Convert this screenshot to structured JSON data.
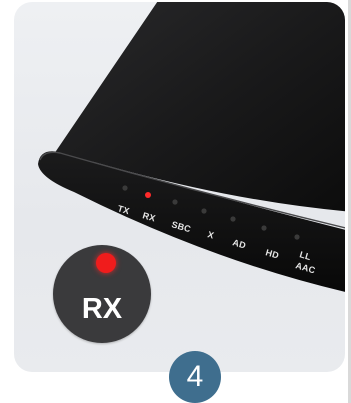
{
  "device": {
    "leds": [
      {
        "label": "TX",
        "lit": false
      },
      {
        "label": "RX",
        "lit": true
      },
      {
        "label": "SBC",
        "lit": false
      },
      {
        "label": "X",
        "lit": false
      },
      {
        "label": "AD",
        "lit": false
      },
      {
        "label": "HD",
        "lit": false
      },
      {
        "label": "LL",
        "label2": "AAC",
        "lit": false
      }
    ]
  },
  "badge": {
    "label": "RX"
  },
  "step": {
    "number": "4"
  },
  "colors": {
    "background": "#e9ebee",
    "device": "#111111",
    "led_on": "#f01c1c",
    "badge": "#3a3a3c",
    "step": "#3f6e8e"
  }
}
